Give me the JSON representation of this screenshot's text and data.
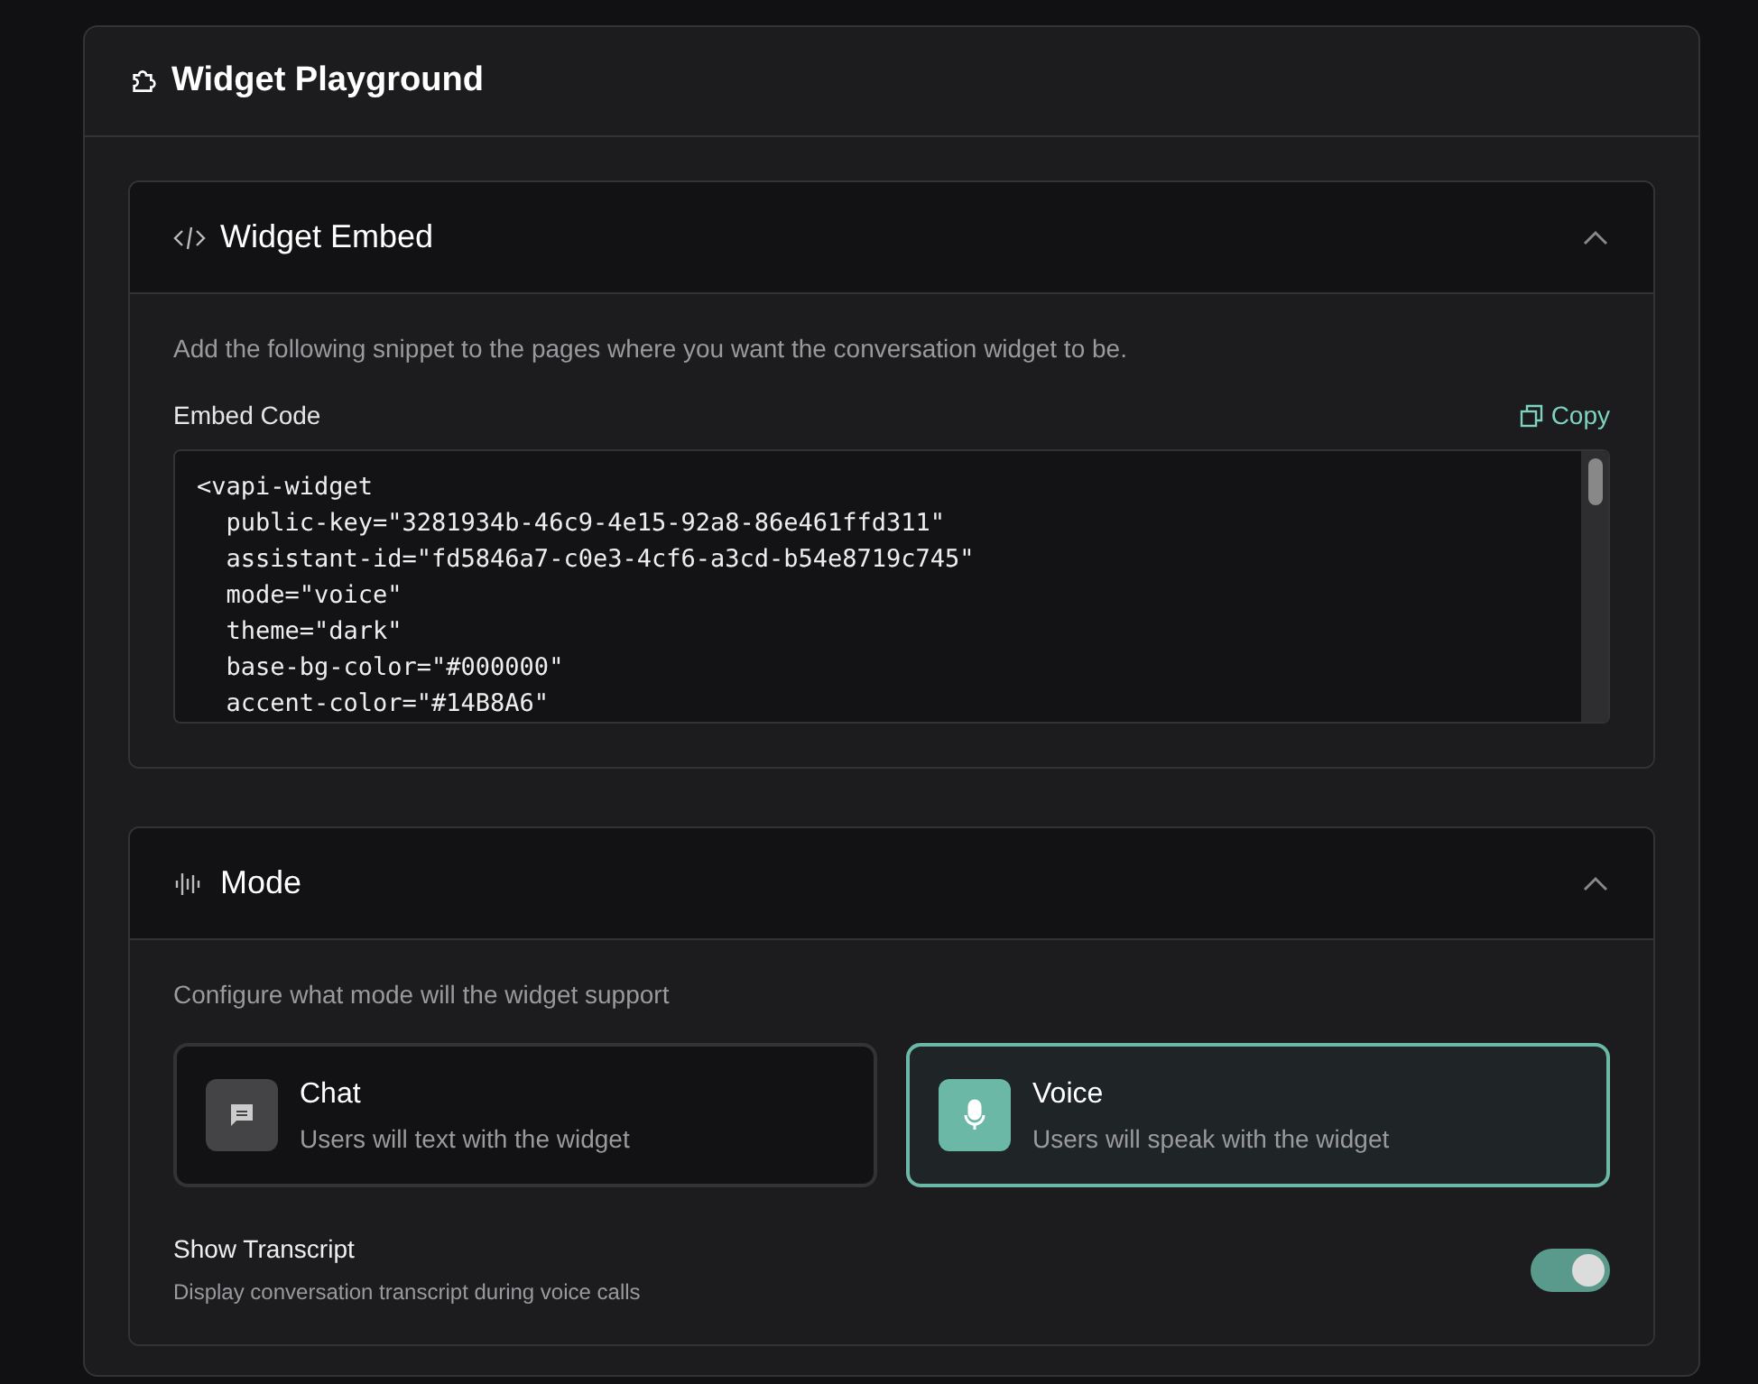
{
  "panel": {
    "title": "Widget Playground"
  },
  "embed": {
    "title": "Widget Embed",
    "expanded": true,
    "description": "Add the following snippet to the pages where you want the conversation widget to be.",
    "code_label": "Embed Code",
    "copy_label": "Copy",
    "code_lines": [
      "<vapi-widget",
      "  public-key=\"3281934b-46c9-4e15-92a8-86e461ffd311\"",
      "  assistant-id=\"fd5846a7-c0e3-4cf6-a3cd-b54e8719c745\"",
      "  mode=\"voice\"",
      "  theme=\"dark\"",
      "  base-bg-color=\"#000000\"",
      "  accent-color=\"#14B8A6\""
    ]
  },
  "mode": {
    "title": "Mode",
    "expanded": true,
    "description": "Configure what mode will the widget support",
    "options": [
      {
        "kind": "chat",
        "title": "Chat",
        "subtitle": "Users will text with the widget",
        "selected": false
      },
      {
        "kind": "voice",
        "title": "Voice",
        "subtitle": "Users will speak with the widget",
        "selected": true
      }
    ],
    "transcript": {
      "label": "Show Transcript",
      "hint": "Display conversation transcript during voice calls",
      "on": true
    }
  }
}
